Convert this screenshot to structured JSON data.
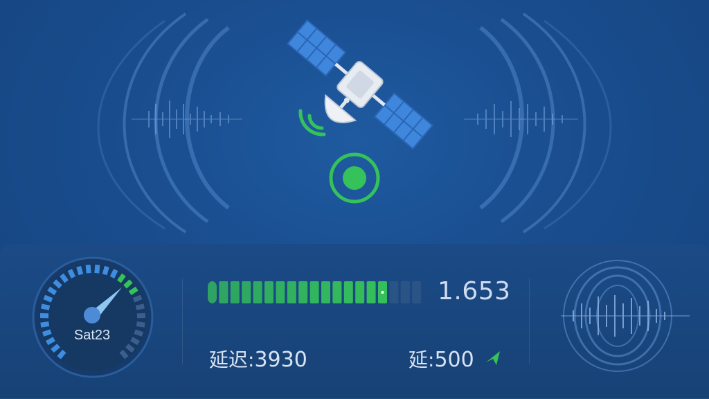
{
  "colors": {
    "background": "#194d8e",
    "accent_green": "#35c25a",
    "panel": "#174276",
    "gauge_blue": "#3e8de0"
  },
  "gauge": {
    "label": "Sat23",
    "level_fraction": 0.73
  },
  "signal_bar": {
    "value": "1.653",
    "filled_segments": 16,
    "total_segments": 19
  },
  "stats": {
    "latency_label": "延迟:",
    "latency_value": "3930",
    "delay_label": "延:",
    "delay_value": "500"
  },
  "icons": {
    "satellite": "satellite-icon",
    "signal_waves": "signal-waves-icon",
    "target": "target-icon",
    "send": "send-arrow-icon"
  }
}
